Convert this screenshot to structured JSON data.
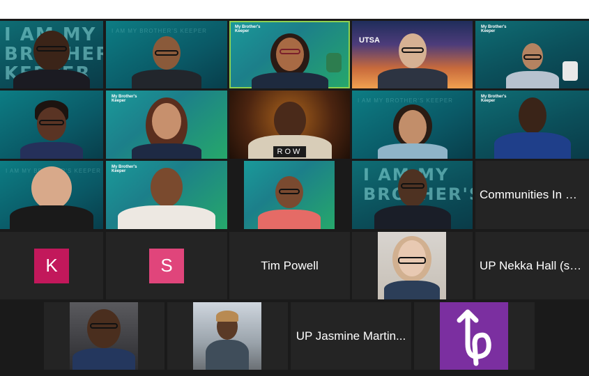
{
  "tiles": {
    "r1": [
      {
        "kind": "video",
        "banner": "I AM MY\nBROTHER'S\nKEEPER"
      },
      {
        "kind": "video",
        "banner_small": "I AM MY BROTHER'S KEEPER"
      },
      {
        "kind": "video",
        "logo": "My Brother's Keeper"
      },
      {
        "kind": "video",
        "logo": "UTSA"
      },
      {
        "kind": "video",
        "logo": "My Brother's Keeper"
      }
    ],
    "r2": [
      {
        "kind": "video"
      },
      {
        "kind": "video",
        "logo": "My Brother's Keeper"
      },
      {
        "kind": "video",
        "shirt_text": "ROW"
      },
      {
        "kind": "video",
        "banner_small": "I AM MY BROTHER'S KEEPER"
      },
      {
        "kind": "video",
        "logo": "My Brother's Keeper"
      }
    ],
    "r3": [
      {
        "kind": "video",
        "banner_small": "I AM MY BROTHER'S KEEPER"
      },
      {
        "kind": "video",
        "logo": "My Brother's Keeper"
      },
      {
        "kind": "video"
      },
      {
        "kind": "video",
        "banner": "I AM MY\nBROTHER'S"
      },
      {
        "kind": "name",
        "name": "Communities In Sc..."
      }
    ],
    "r4": [
      {
        "kind": "avatar",
        "letter": "K",
        "color": "#c2185b"
      },
      {
        "kind": "avatar",
        "letter": "S",
        "color": "#e0457b"
      },
      {
        "kind": "name",
        "name": "Tim Powell"
      },
      {
        "kind": "video"
      },
      {
        "kind": "name",
        "name": "UP Nekka Hall (she..."
      }
    ],
    "r5": [
      {
        "kind": "video"
      },
      {
        "kind": "video"
      },
      {
        "kind": "name",
        "name": "UP Jasmine Martin..."
      },
      {
        "kind": "logo",
        "color": "#7b2fa0"
      }
    ]
  },
  "colors": {
    "background": "#1a1a1a",
    "tile": "#242424",
    "text": "#ffffff",
    "speaking_border": "#8fd14f"
  },
  "icons": {
    "r5_logo": "up-logo-icon"
  }
}
